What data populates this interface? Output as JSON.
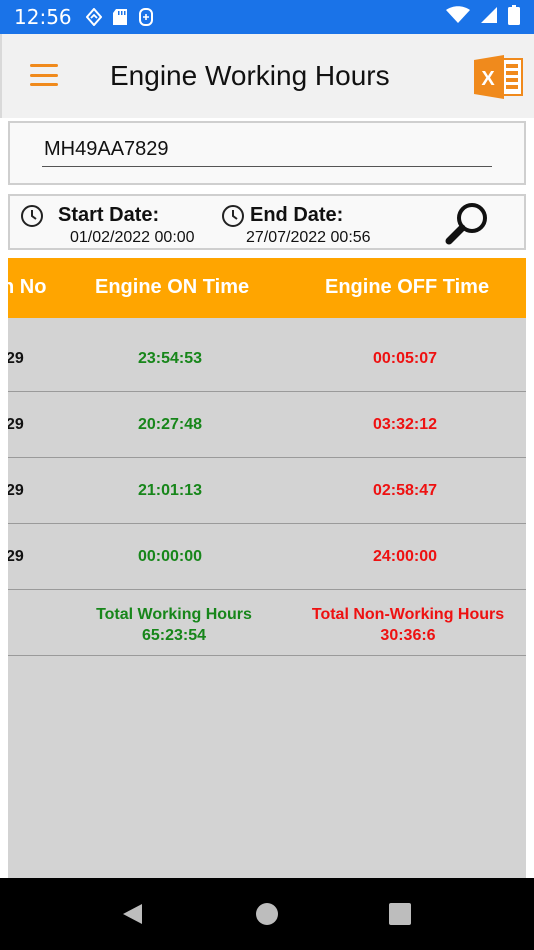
{
  "status_bar": {
    "time": "12:56",
    "icons_left": [
      "navigation-icon",
      "sd-card-icon",
      "sync-icon"
    ],
    "icons_right": [
      "wifi-icon",
      "signal-icon",
      "battery-icon"
    ]
  },
  "app_bar": {
    "title": "Engine Working Hours",
    "menu_icon": "hamburger-menu-icon",
    "export_icon": "excel-icon",
    "export_icon_letter": "X",
    "accent_color": "#f08a1c"
  },
  "vehicle": {
    "number": "MH49AA7829"
  },
  "date_range": {
    "start_label": "Start Date:",
    "start_value": "01/02/2022 00:00",
    "end_label": "End Date:",
    "end_value": "27/07/2022 00:56",
    "search_icon": "search-icon"
  },
  "table": {
    "header_color": "#ffa500",
    "columns": [
      "n No",
      "Engine ON Time",
      "Engine OFF Time"
    ],
    "rows": [
      {
        "no": "29",
        "on": "23:54:53",
        "off": "00:05:07"
      },
      {
        "no": "29",
        "on": "20:27:48",
        "off": "03:32:12"
      },
      {
        "no": "29",
        "on": "21:01:13",
        "off": "02:58:47"
      },
      {
        "no": "29",
        "on": "00:00:00",
        "off": "24:00:00"
      }
    ],
    "totals": {
      "working_label": "Total Working Hours",
      "working_value": "65:23:54",
      "nonworking_label": "Total Non-Working Hours",
      "nonworking_value": "30:36:6"
    },
    "on_color": "#17861a",
    "off_color": "#ee1111"
  },
  "nav_bar": {
    "buttons": [
      "back-icon",
      "home-icon",
      "recents-icon"
    ]
  }
}
